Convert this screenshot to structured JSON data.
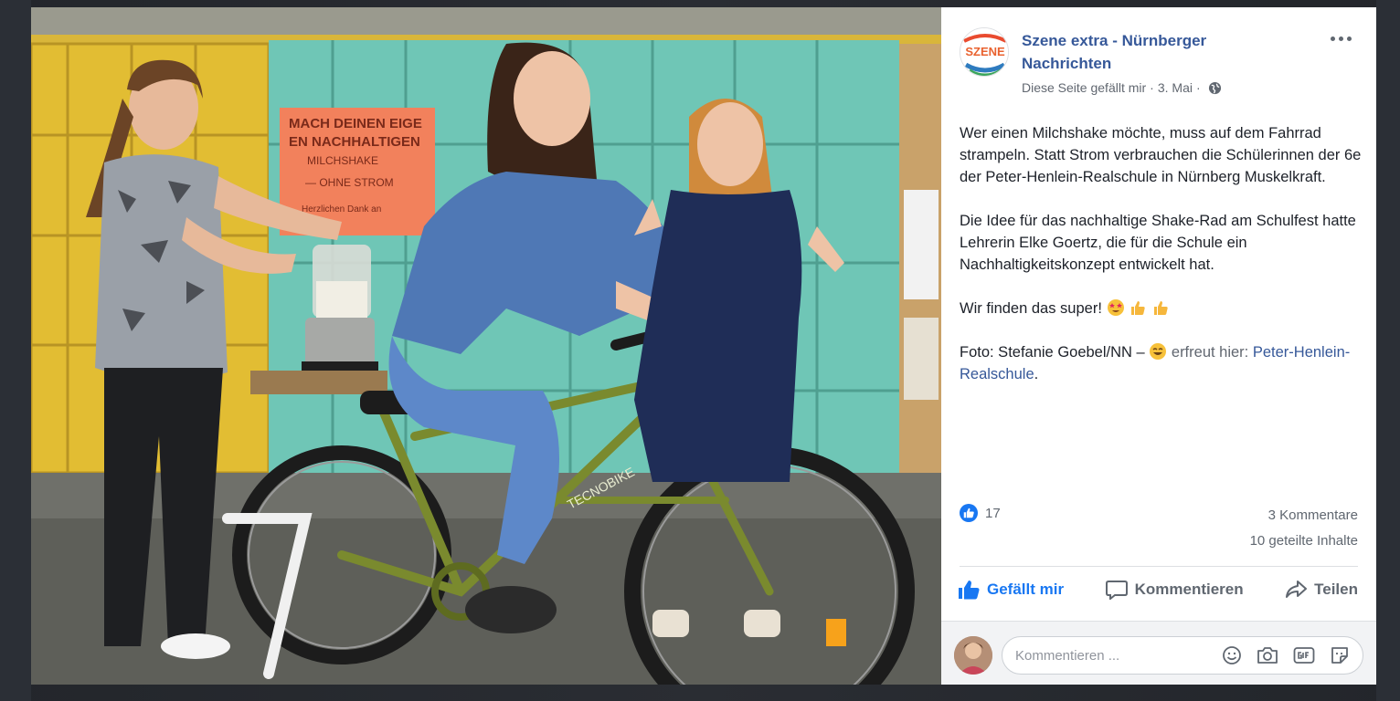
{
  "post": {
    "page_name": "Szene extra - Nürnberger Nachrichten",
    "meta_like_page": "Diese Seite gefällt mir",
    "meta_separator": "·",
    "meta_date": "3. Mai",
    "avatar_text": "SZENE",
    "paragraphs": [
      "Wer einen Milchshake möchte, muss auf dem Fahrrad strampeln. Statt Strom verbrauchen die Schülerinnen der 6e der Peter-Henlein-Realschule in Nürnberg Muskelkraft.",
      "Die Idee für das nachhaltige Shake-Rad am Schulfest hatte Lehrerin Elke Goertz, die für die Schule ein Nachhaltigkeitskonzept entwickelt hat."
    ],
    "p3_text": "Wir finden das super!",
    "p4_prefix": "Foto: Stefanie Goebel/NN –",
    "p4_feeling": "erfreut hier:",
    "p4_link": "Peter-Henlein-Realschule",
    "p4_end": "."
  },
  "stats": {
    "likes": "17",
    "comments": "3 Kommentare",
    "shares": "10 geteilte Inhalte"
  },
  "actions": {
    "like": "Gefällt mir",
    "comment": "Kommentieren",
    "share": "Teilen"
  },
  "comment_box": {
    "placeholder": "Kommentieren ..."
  },
  "photo": {
    "poster_lines": [
      "MACH DEINEN EIGE",
      "EN NACHHALTIGEN",
      "MILCHSHAKE",
      "— OHNE STROM",
      "Herzlichen Dank an"
    ],
    "bike_brand": "TECNOBIKE"
  },
  "colors": {
    "link": "#365899",
    "like_blue": "#1877f2",
    "locker_yellow": "#e8c33a",
    "locker_teal": "#6fc6b6",
    "bike_green": "#7a8a2e"
  }
}
